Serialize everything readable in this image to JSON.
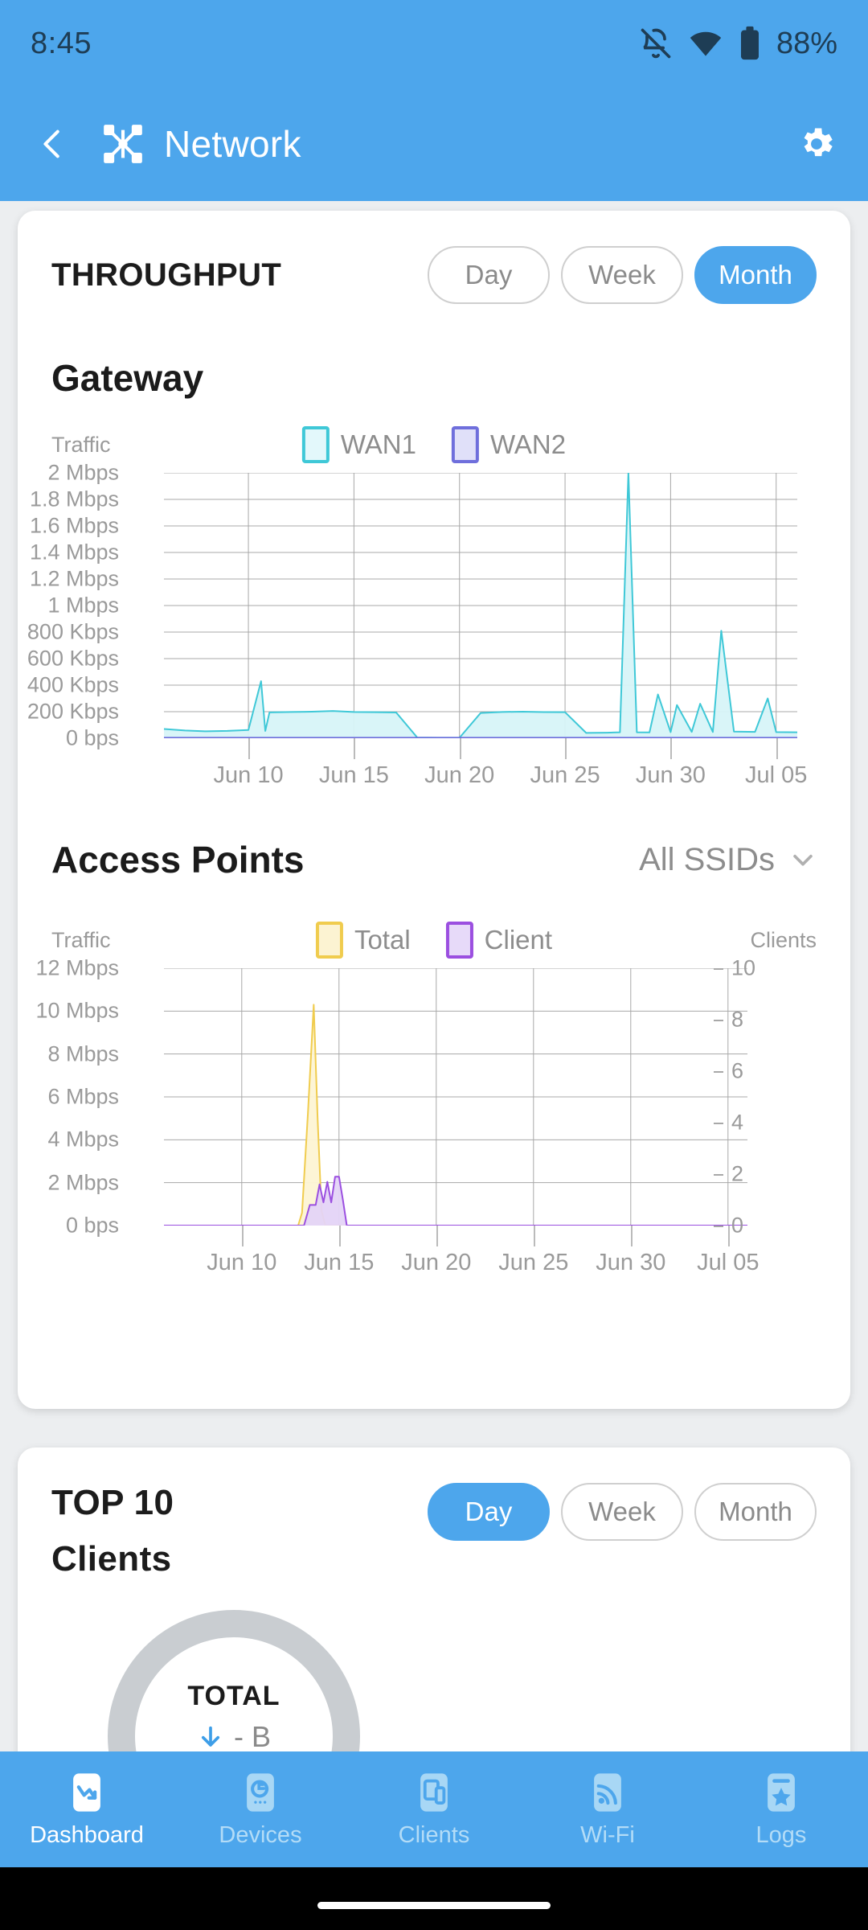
{
  "status_bar": {
    "time": "8:45",
    "battery_percent": "88%",
    "icons": [
      "bell-off-icon",
      "wifi-icon",
      "battery-icon"
    ]
  },
  "app_bar": {
    "back_icon": "chevron-left-icon",
    "network_icon": "network-topology-icon",
    "title": "Network",
    "settings_icon": "gear-icon"
  },
  "throughput": {
    "section_title": "THROUGHPUT",
    "range_options": [
      "Day",
      "Week",
      "Month"
    ],
    "range_selected": "Month",
    "gateway": {
      "title": "Gateway",
      "traffic_label": "Traffic",
      "legend": [
        {
          "label": "WAN1",
          "color": "#3fc8d7"
        },
        {
          "label": "WAN2",
          "color": "#6f6fdc"
        }
      ]
    },
    "access_points": {
      "title": "Access Points",
      "ssid_filter": "All SSIDs",
      "ssid_chevron": "chevron-down-icon",
      "traffic_label": "Traffic",
      "clients_label": "Clients",
      "legend": [
        {
          "label": "Total",
          "color": "#f0cc4e"
        },
        {
          "label": "Client",
          "color": "#9b4fe0"
        }
      ]
    }
  },
  "top10": {
    "section_title_line1": "TOP 10",
    "section_title_line2": "Clients",
    "range_options": [
      "Day",
      "Week",
      "Month"
    ],
    "range_selected": "Day",
    "donut": {
      "label": "TOTAL",
      "download_icon": "arrow-down-icon",
      "value": "- B",
      "track_color": "#c9cdd1"
    }
  },
  "bottom_nav": {
    "items": [
      {
        "label": "Dashboard",
        "icon": "dashboard-chart-icon",
        "active": true
      },
      {
        "label": "Devices",
        "icon": "devices-gateway-icon",
        "active": false
      },
      {
        "label": "Clients",
        "icon": "clients-phone-tablet-icon",
        "active": false
      },
      {
        "label": "Wi-Fi",
        "icon": "wifi-signal-icon",
        "active": false
      },
      {
        "label": "Logs",
        "icon": "logs-star-icon",
        "active": false
      }
    ]
  },
  "chart_data": [
    {
      "id": "gateway-throughput",
      "type": "area",
      "title": "Gateway",
      "ylabel": "Traffic",
      "xlabel": "",
      "ylim": [
        0,
        2000000
      ],
      "ytick_labels": [
        "2 Mbps",
        "1.8 Mbps",
        "1.6 Mbps",
        "1.4 Mbps",
        "1.2 Mbps",
        "1 Mbps",
        "800 Kbps",
        "600 Kbps",
        "400 Kbps",
        "200 Kbps",
        "0 bps"
      ],
      "ytick_values": [
        2000000,
        1800000,
        1600000,
        1400000,
        1200000,
        1000000,
        800000,
        600000,
        400000,
        200000,
        0
      ],
      "xtick_labels": [
        "Jun 10",
        "Jun 15",
        "Jun 20",
        "Jun 25",
        "Jun 30",
        "Jul 05"
      ],
      "x_range": [
        "Jun 06",
        "Jul 06"
      ],
      "grid": true,
      "legend_position": "top-center",
      "series": [
        {
          "name": "WAN1",
          "color": "#3fc8d7",
          "fill": "#d7f4f8",
          "unit": "Kbps",
          "x": [
            "Jun 06",
            "Jun 07",
            "Jun 08",
            "Jun 09",
            "Jun 10",
            "Jun 10.6",
            "Jun 10.8",
            "Jun 11",
            "Jun 12",
            "Jun 13",
            "Jun 14",
            "Jun 15",
            "Jun 16",
            "Jun 17",
            "Jun 18",
            "Jun 19",
            "Jun 20",
            "Jun 21",
            "Jun 22",
            "Jun 23",
            "Jun 24",
            "Jun 25",
            "Jun 26",
            "Jun 27",
            "Jun 27.6",
            "Jun 28",
            "Jun 28.4",
            "Jun 29",
            "Jun 29.4",
            "Jun 30",
            "Jun 30.3",
            "Jul 01",
            "Jul 01.4",
            "Jul 02",
            "Jul 02.4",
            "Jul 03",
            "Jul 04",
            "Jul 04.6",
            "Jul 05",
            "Jul 06"
          ],
          "values": [
            70,
            58,
            52,
            55,
            62,
            430,
            55,
            195,
            198,
            200,
            205,
            198,
            196,
            194,
            5,
            4,
            4,
            190,
            198,
            200,
            197,
            196,
            40,
            42,
            45,
            2000,
            45,
            44,
            330,
            46,
            250,
            48,
            260,
            47,
            810,
            50,
            48,
            300,
            46,
            45
          ]
        },
        {
          "name": "WAN2",
          "color": "#6f6fdc",
          "fill": "#dcdcf7",
          "unit": "Kbps",
          "x": [
            "Jun 06",
            "Jun 10",
            "Jun 15",
            "Jun 20",
            "Jun 25",
            "Jun 30",
            "Jul 05",
            "Jul 06"
          ],
          "values": [
            4,
            4,
            4,
            4,
            4,
            4,
            4,
            4
          ]
        }
      ]
    },
    {
      "id": "access-points-throughput",
      "type": "area",
      "title": "Access Points",
      "ylabel": "Traffic",
      "y2label": "Clients",
      "ylim": [
        0,
        12000000
      ],
      "ytick_labels": [
        "12 Mbps",
        "10 Mbps",
        "8 Mbps",
        "6 Mbps",
        "4 Mbps",
        "2 Mbps",
        "0 bps"
      ],
      "ytick_values": [
        12000000,
        10000000,
        8000000,
        6000000,
        4000000,
        2000000,
        0
      ],
      "y2lim": [
        0,
        10
      ],
      "y2tick_labels": [
        "10",
        "8",
        "6",
        "4",
        "2",
        "0"
      ],
      "y2tick_values": [
        10,
        8,
        6,
        4,
        2,
        0
      ],
      "xtick_labels": [
        "Jun 10",
        "Jun 15",
        "Jun 20",
        "Jun 25",
        "Jun 30",
        "Jul 05"
      ],
      "x_range": [
        "Jun 06",
        "Jul 06"
      ],
      "grid": true,
      "legend_position": "top-center",
      "series": [
        {
          "name": "Total",
          "axis": "left",
          "color": "#f0cc4e",
          "fill": "#fdf4d4",
          "unit": "Mbps",
          "x": [
            "Jun 06",
            "Jun 12.9",
            "Jun 13.1",
            "Jun 13.4",
            "Jun 13.7",
            "Jun 13.9",
            "Jun 14.1",
            "Jun 14.3",
            "Jun 20",
            "Jun 25",
            "Jun 30",
            "Jul 05",
            "Jul 06"
          ],
          "values": [
            0,
            0,
            0.6,
            5.2,
            10.3,
            5.0,
            0.7,
            0,
            0,
            0,
            0,
            0,
            0
          ]
        },
        {
          "name": "Client",
          "axis": "right",
          "color": "#9b4fe0",
          "fill": "#e4d4f7",
          "unit": "clients",
          "x": [
            "Jun 06",
            "Jun 13.2",
            "Jun 13.5",
            "Jun 13.8",
            "Jun 14.0",
            "Jun 14.2",
            "Jun 14.4",
            "Jun 14.6",
            "Jun 14.8",
            "Jun 15.0",
            "Jun 15.2",
            "Jun 15.4",
            "Jun 20",
            "Jul 06"
          ],
          "values": [
            0,
            0,
            0.8,
            0.8,
            1.6,
            0.9,
            1.7,
            0.9,
            1.9,
            1.9,
            1.0,
            0,
            0,
            0
          ]
        }
      ]
    }
  ]
}
